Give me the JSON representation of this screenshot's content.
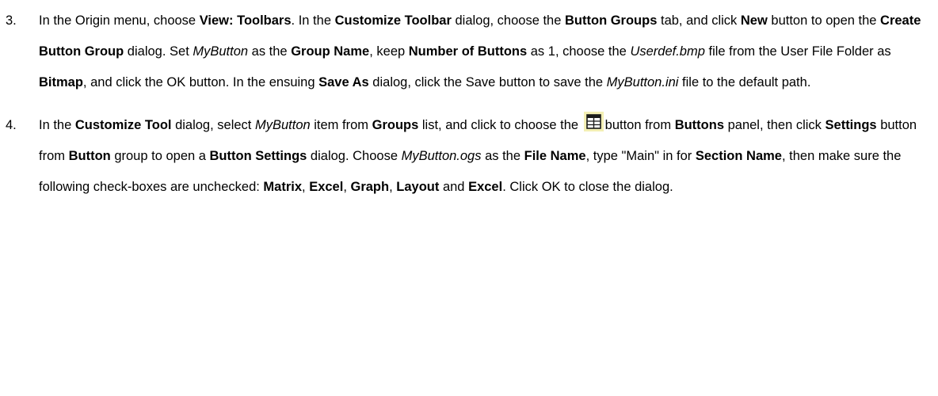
{
  "steps": [
    {
      "number": "3.",
      "segments": [
        {
          "text": "In the Origin menu, choose ",
          "style": "normal"
        },
        {
          "text": "View: Toolbars",
          "style": "bold"
        },
        {
          "text": ". In the ",
          "style": "normal"
        },
        {
          "text": "Customize Toolbar",
          "style": "bold"
        },
        {
          "text": " dialog, choose the ",
          "style": "normal"
        },
        {
          "text": "Button Groups",
          "style": "bold"
        },
        {
          "text": " tab, and click ",
          "style": "normal"
        },
        {
          "text": "New",
          "style": "bold"
        },
        {
          "text": " button to open the ",
          "style": "normal"
        },
        {
          "text": "Create Button Group",
          "style": "bold"
        },
        {
          "text": " dialog. Set ",
          "style": "normal"
        },
        {
          "text": "MyButton",
          "style": "italic"
        },
        {
          "text": " as the ",
          "style": "normal"
        },
        {
          "text": "Group Name",
          "style": "bold"
        },
        {
          "text": ", keep ",
          "style": "normal"
        },
        {
          "text": "Number of Buttons",
          "style": "bold"
        },
        {
          "text": " as 1, choose the ",
          "style": "normal"
        },
        {
          "text": "Userdef.bmp",
          "style": "italic"
        },
        {
          "text": " file from the User File Folder as ",
          "style": "normal"
        },
        {
          "text": "Bitmap",
          "style": "bold"
        },
        {
          "text": ", and click the OK button. In the ensuing ",
          "style": "normal"
        },
        {
          "text": "Save As",
          "style": "bold"
        },
        {
          "text": " dialog, click the Save button to save the ",
          "style": "normal"
        },
        {
          "text": "MyButton.ini",
          "style": "italic"
        },
        {
          "text": " file to the default path.",
          "style": "normal"
        }
      ]
    },
    {
      "number": "4.",
      "segments": [
        {
          "text": "In the ",
          "style": "normal"
        },
        {
          "text": "Customize Tool",
          "style": "bold"
        },
        {
          "text": " dialog, select ",
          "style": "normal"
        },
        {
          "text": "MyButton",
          "style": "italic"
        },
        {
          "text": " item from ",
          "style": "normal"
        },
        {
          "text": "Groups",
          "style": "bold"
        },
        {
          "text": " list, and click to choose the ",
          "style": "normal"
        },
        {
          "icon": "worksheet-grid-icon",
          "style": "icon"
        },
        {
          "text": "button from ",
          "style": "normal"
        },
        {
          "text": "Buttons",
          "style": "bold"
        },
        {
          "text": " panel, then click ",
          "style": "normal"
        },
        {
          "text": "Settings",
          "style": "bold"
        },
        {
          "text": " button from ",
          "style": "normal"
        },
        {
          "text": "Button",
          "style": "bold"
        },
        {
          "text": " group to open a ",
          "style": "normal"
        },
        {
          "text": "Button Settings",
          "style": "bold"
        },
        {
          "text": " dialog. Choose ",
          "style": "normal"
        },
        {
          "text": "MyButton.ogs",
          "style": "italic"
        },
        {
          "text": " as the ",
          "style": "normal"
        },
        {
          "text": "File Name",
          "style": "bold"
        },
        {
          "text": ", type \"Main\" in for ",
          "style": "normal"
        },
        {
          "text": "Section Name",
          "style": "bold"
        },
        {
          "text": ", then make sure the following check-boxes are unchecked: ",
          "style": "normal"
        },
        {
          "text": "Matrix",
          "style": "bold"
        },
        {
          "text": ", ",
          "style": "normal"
        },
        {
          "text": "Excel",
          "style": "bold"
        },
        {
          "text": ", ",
          "style": "normal"
        },
        {
          "text": "Graph",
          "style": "bold"
        },
        {
          "text": ", ",
          "style": "normal"
        },
        {
          "text": "Layout",
          "style": "bold"
        },
        {
          "text": " and ",
          "style": "normal"
        },
        {
          "text": "Excel",
          "style": "bold"
        },
        {
          "text": ". Click OK to close the dialog.",
          "style": "normal"
        }
      ]
    }
  ],
  "icon_colors": {
    "background": "#f3efb4",
    "grid": "#1a1a1a",
    "header": "#1a1a1a",
    "cell": "#ffffff"
  }
}
